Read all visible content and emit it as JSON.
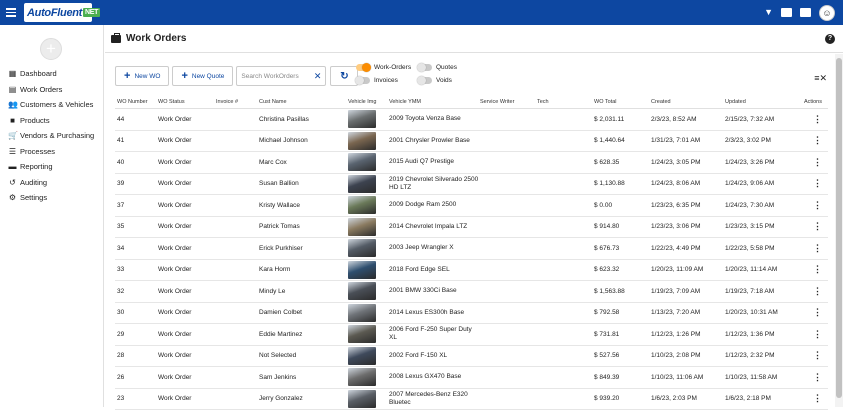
{
  "app": {
    "logo_text": "AutoFluent",
    "logo_suffix": "NET"
  },
  "header": {
    "avatar_char": "☺"
  },
  "sidebar": {
    "add_label": "+",
    "items": [
      {
        "label": "Dashboard",
        "icon": "dashboard-icon",
        "glyph": "▦"
      },
      {
        "label": "Work Orders",
        "icon": "clipboard-icon",
        "glyph": "▤"
      },
      {
        "label": "Customers & Vehicles",
        "icon": "people-icon",
        "glyph": "👥"
      },
      {
        "label": "Products",
        "icon": "box-icon",
        "glyph": "■"
      },
      {
        "label": "Vendors & Purchasing",
        "icon": "cart-icon",
        "glyph": "🛒"
      },
      {
        "label": "Processes",
        "icon": "list-icon",
        "glyph": "☰"
      },
      {
        "label": "Reporting",
        "icon": "chart-icon",
        "glyph": "▬"
      },
      {
        "label": "Auditing",
        "icon": "history-icon",
        "glyph": "↺"
      },
      {
        "label": "Settings",
        "icon": "gear-icon",
        "glyph": "⚙"
      }
    ]
  },
  "page": {
    "title": "Work Orders",
    "help": "?"
  },
  "toolbar": {
    "new_wo": "New WO",
    "new_quote": "New Quote",
    "search_placeholder": "Search WorkOrders",
    "search_clear": "✕",
    "refresh": "↻"
  },
  "filters": {
    "work_orders": {
      "label": "Work-Orders",
      "on": true
    },
    "quotes": {
      "label": "Quotes",
      "on": false
    },
    "invoices": {
      "label": "Invoices",
      "on": false
    },
    "voids": {
      "label": "Voids",
      "on": false
    }
  },
  "columns": {
    "wo_number": "WO Number",
    "wo_status": "WO Status",
    "invoice": "Invoice #",
    "cust_name": "Cust Name",
    "vehicle_img": "Vehicle Img",
    "vehicle_ymm": "Vehicle YMM",
    "service_writer": "Service Writer",
    "tech": "Tech",
    "wo_total": "WO Total",
    "created": "Created",
    "updated": "Updated",
    "actions": "Actions"
  },
  "rows": [
    {
      "num": "44",
      "status": "Work Order",
      "invoice": "",
      "cust": "Christina Pasillas",
      "color": "#6a6e6f",
      "ymm": "2009 Toyota Venza Base",
      "sw": "",
      "tech": "",
      "total": "$ 2,031.11",
      "created": "2/3/23, 8:52 AM",
      "updated": "2/15/23, 7:32 AM"
    },
    {
      "num": "41",
      "status": "Work Order",
      "invoice": "",
      "cust": "Michael Johnson",
      "color": "#7a6650",
      "ymm": "2001 Chrysler Prowler Base",
      "sw": "",
      "tech": "",
      "total": "$ 1,440.64",
      "created": "1/31/23, 7:01 AM",
      "updated": "2/3/23, 3:02 PM"
    },
    {
      "num": "40",
      "status": "Work Order",
      "invoice": "",
      "cust": "Marc Cox",
      "color": "#5a6470",
      "ymm": "2015 Audi Q7 Prestige",
      "sw": "",
      "tech": "",
      "total": "$ 628.35",
      "created": "1/24/23, 3:05 PM",
      "updated": "1/24/23, 3:26 PM"
    },
    {
      "num": "39",
      "status": "Work Order",
      "invoice": "",
      "cust": "Susan Ballion",
      "color": "#3d4350",
      "ymm": "2019 Chevrolet Silverado 2500 HD LTZ",
      "sw": "",
      "tech": "",
      "total": "$ 1,130.88",
      "created": "1/24/23, 8:06 AM",
      "updated": "1/24/23, 9:06 AM"
    },
    {
      "num": "37",
      "status": "Work Order",
      "invoice": "",
      "cust": "Kristy Wallace",
      "color": "#6b7a5a",
      "ymm": "2009 Dodge Ram 2500",
      "sw": "",
      "tech": "",
      "total": "$ 0.00",
      "created": "1/23/23, 6:35 PM",
      "updated": "1/24/23, 7:30 AM"
    },
    {
      "num": "35",
      "status": "Work Order",
      "invoice": "",
      "cust": "Patrick Tomas",
      "color": "#8a7a60",
      "ymm": "2014 Chevrolet Impala LTZ",
      "sw": "",
      "tech": "",
      "total": "$ 914.80",
      "created": "1/23/23, 3:06 PM",
      "updated": "1/23/23, 3:15 PM"
    },
    {
      "num": "34",
      "status": "Work Order",
      "invoice": "",
      "cust": "Erick Purkhiser",
      "color": "#545c66",
      "ymm": "2003 Jeep Wrangler X",
      "sw": "",
      "tech": "",
      "total": "$ 676.73",
      "created": "1/22/23, 4:49 PM",
      "updated": "1/22/23, 5:58 PM"
    },
    {
      "num": "33",
      "status": "Work Order",
      "invoice": "",
      "cust": "Kara Horm",
      "color": "#2f4f6f",
      "ymm": "2018 Ford Edge SEL",
      "sw": "",
      "tech": "",
      "total": "$ 623.32",
      "created": "1/20/23, 11:09 AM",
      "updated": "1/20/23, 11:14 AM"
    },
    {
      "num": "32",
      "status": "Work Order",
      "invoice": "",
      "cust": "Mindy Le",
      "color": "#4a4f57",
      "ymm": "2001 BMW 330Ci Base",
      "sw": "",
      "tech": "",
      "total": "$ 1,563.88",
      "created": "1/19/23, 7:09 AM",
      "updated": "1/19/23, 7:18 AM"
    },
    {
      "num": "30",
      "status": "Work Order",
      "invoice": "",
      "cust": "Damien Colbet",
      "color": "#6f7378",
      "ymm": "2014 Lexus ES300h Base",
      "sw": "",
      "tech": "",
      "total": "$ 792.58",
      "created": "1/13/23, 7:20 AM",
      "updated": "1/20/23, 10:31 AM"
    },
    {
      "num": "29",
      "status": "Work Order",
      "invoice": "",
      "cust": "Eddie Martinez",
      "color": "#5c5a52",
      "ymm": "2006 Ford F-250 Super Duty XL",
      "sw": "",
      "tech": "",
      "total": "$ 731.81",
      "created": "1/12/23, 1:26 PM",
      "updated": "1/12/23, 1:36 PM"
    },
    {
      "num": "28",
      "status": "Work Order",
      "invoice": "",
      "cust": "Not Selected",
      "color": "#3f4a5c",
      "ymm": "2002 Ford F-150 XL",
      "sw": "",
      "tech": "",
      "total": "$ 527.56",
      "created": "1/10/23, 2:08 PM",
      "updated": "1/12/23, 2:32 PM"
    },
    {
      "num": "26",
      "status": "Work Order",
      "invoice": "",
      "cust": "Sam Jenkins",
      "color": "#6d6d6d",
      "ymm": "2008 Lexus GX470 Base",
      "sw": "",
      "tech": "",
      "total": "$ 849.39",
      "created": "1/10/23, 11:06 AM",
      "updated": "1/10/23, 11:58 AM"
    },
    {
      "num": "23",
      "status": "Work Order",
      "invoice": "",
      "cust": "Jerry Gonzalez",
      "color": "#5a5f66",
      "ymm": "2007 Mercedes-Benz E320 Bluetec",
      "sw": "",
      "tech": "",
      "total": "$ 939.20",
      "created": "1/6/23, 2:03 PM",
      "updated": "1/6/23, 2:18 PM"
    }
  ]
}
